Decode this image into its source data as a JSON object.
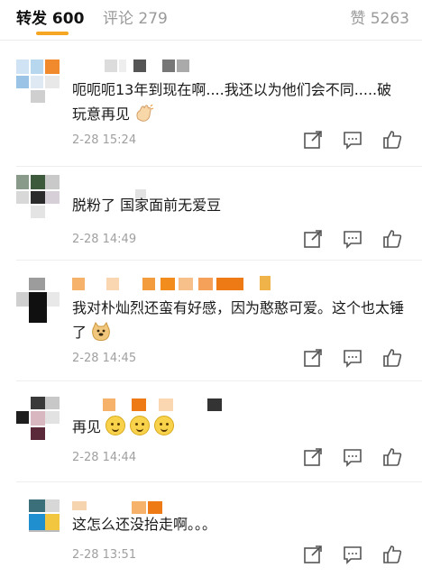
{
  "tabs": {
    "repost": "转发 600",
    "comment": "评论 279",
    "like": "赞 5263"
  },
  "comments": [
    {
      "text": "呃呃呃13年到现在啊....我还以为他们会不同.....破玩意再见",
      "emoji": "waving-hand",
      "time": "2-28 15:24"
    },
    {
      "text": "脱粉了 国家面前无爱豆",
      "time": "2-28 14:49"
    },
    {
      "text": "我对朴灿烈还蛮有好感，因为憨憨可爱。这个也太锤了",
      "emoji": "doge",
      "time": "2-28 14:45"
    },
    {
      "text": "再见",
      "emoji": "smile-x3",
      "time": "2-28 14:44"
    },
    {
      "text": "这怎么还没抬走啊。。。",
      "time": "2-28 13:51"
    }
  ],
  "icons": {
    "repost": "share-arrow-icon",
    "comment": "comment-bubble-icon",
    "like": "thumbs-up-icon"
  },
  "colors": {
    "accent": "#f5a623",
    "muted": "#9a9a9a"
  }
}
